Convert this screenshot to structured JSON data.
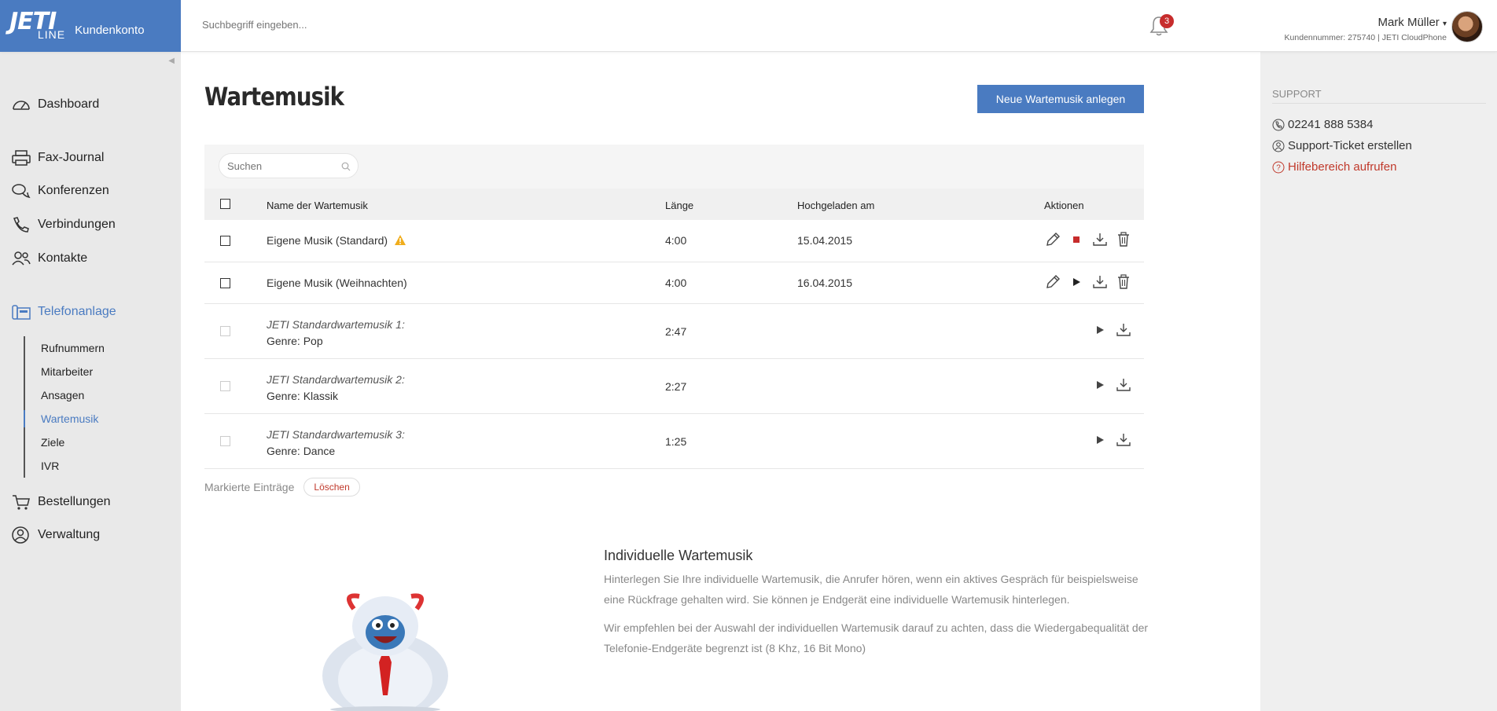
{
  "brand": {
    "logo_top": "JETI",
    "logo_bottom": "LINE",
    "subtitle": "Kundenkonto"
  },
  "topbar": {
    "search_placeholder": "Suchbegriff eingeben...",
    "notifications_count": "3",
    "user_name": "Mark Müller",
    "user_caret": "▾",
    "user_meta": "Kundennummer: 275740 | JETI CloudPhone"
  },
  "sidebar": {
    "collapse": "◀",
    "items": [
      {
        "label": "Dashboard",
        "icon": "speedometer-icon"
      },
      {
        "label": "Fax-Journal",
        "icon": "printer-icon"
      },
      {
        "label": "Konferenzen",
        "icon": "chat-bubbles-icon"
      },
      {
        "label": "Verbindungen",
        "icon": "phone-icon"
      },
      {
        "label": "Kontakte",
        "icon": "users-icon"
      },
      {
        "label": "Telefonanlage",
        "icon": "phone-system-icon"
      },
      {
        "label": "Bestellungen",
        "icon": "cart-icon"
      },
      {
        "label": "Verwaltung",
        "icon": "user-circle-icon"
      }
    ],
    "sub_items": [
      "Rufnummern",
      "Mitarbeiter",
      "Ansagen",
      "Wartemusik",
      "Ziele",
      "IVR"
    ],
    "active_item": "Telefonanlage",
    "active_sub": "Wartemusik",
    "accent_color": "#4a7bc1"
  },
  "main": {
    "title": "Wartemusik",
    "new_button": "Neue Wartemusik anlegen",
    "search_placeholder": "Suchen",
    "columns": {
      "name": "Name der Wartemusik",
      "length": "Länge",
      "uploaded": "Hochgeladen am",
      "actions": "Aktionen"
    },
    "rows": [
      {
        "name": "Eigene Musik (Standard)",
        "length": "4:00",
        "date": "15.04.2015",
        "warning": true
      },
      {
        "name": "Eigene Musik (Weihnachten)",
        "length": "4:00",
        "date": "16.04.2015",
        "warning": false
      },
      {
        "name": "JETI Standardwartemusik 1:",
        "genre": "Genre: Pop",
        "length": "2:47"
      },
      {
        "name": "JETI Standardwartemusik 2:",
        "genre": "Genre: Klassik",
        "length": "2:27"
      },
      {
        "name": "JETI Standardwartemusik 3:",
        "genre": "Genre: Dance",
        "length": "1:25"
      }
    ],
    "marked_label": "Markierte Einträge",
    "delete_button": "Löschen",
    "info_title": "Individuelle Wartemusik",
    "info_p1": "Hinterlegen Sie Ihre individuelle Wartemusik, die Anrufer hören, wenn ein aktives Gespräch für beispielsweise eine Rückfrage gehalten wird. Sie können je Endgerät eine individuelle Wartemusik hinterlegen.",
    "info_p2": "Wir empfehlen bei der Auswahl der individuellen Wartemusik darauf zu achten, dass die Wiedergabequalität der Telefonie-Endgeräte begrenzt ist (8 Khz, 16 Bit Mono)"
  },
  "support": {
    "heading": "SUPPORT",
    "phone": "02241 888 5384",
    "ticket": "Support-Ticket erstellen",
    "help": "Hilfebereich aufrufen"
  }
}
